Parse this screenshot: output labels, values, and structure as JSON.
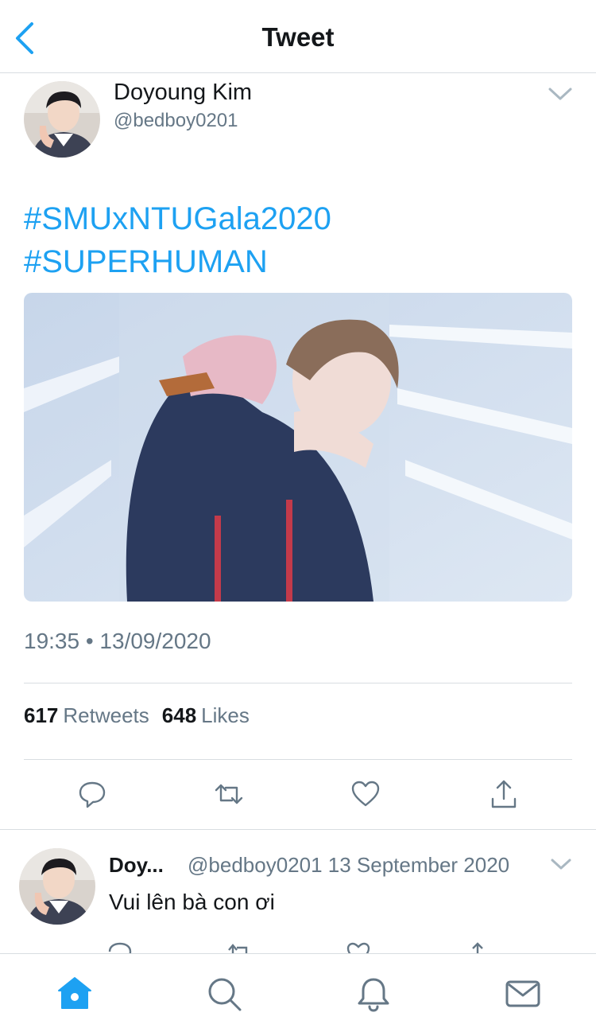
{
  "header": {
    "title": "Tweet"
  },
  "tweet": {
    "author_name": "Doyoung Kim",
    "author_handle": "@bedboy0201",
    "hashtags": [
      "#SMUxNTUGala2020",
      "#SUPERHUMAN"
    ],
    "timestamp": "19:35 • 13/09/2020",
    "retweets": "617",
    "retweets_label": "Retweets",
    "likes": "648",
    "likes_label": "Likes"
  },
  "reply": {
    "author_name": "Doy...",
    "meta": "@bedboy0201 13 September 2020",
    "text": "Vui lên bà con ơi"
  },
  "colors": {
    "accent": "#1da1f2",
    "secondary_text": "#657786",
    "divider": "#d8dde1"
  }
}
